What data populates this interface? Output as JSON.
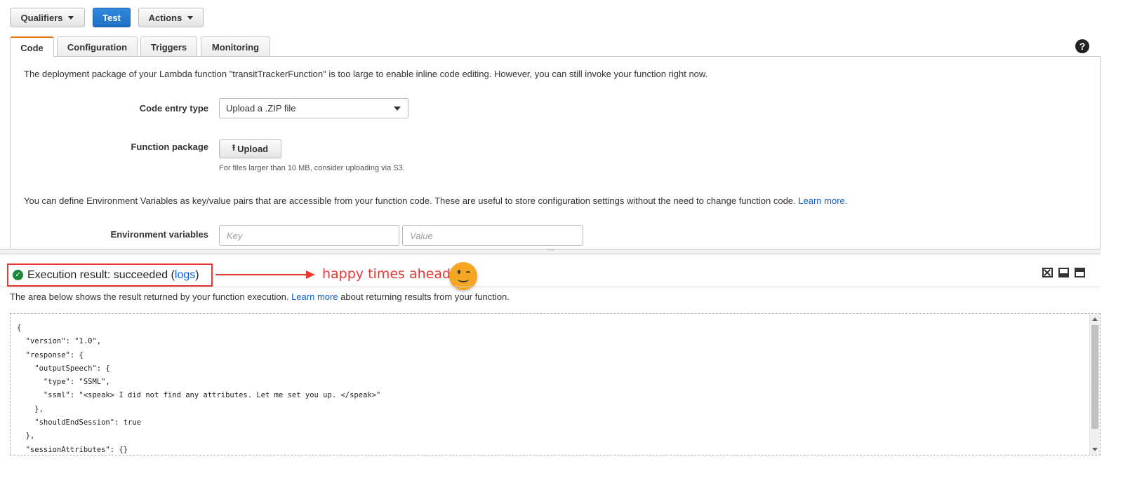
{
  "toolbar": {
    "qualifiers_label": "Qualifiers",
    "test_label": "Test",
    "actions_label": "Actions"
  },
  "tabs": [
    {
      "label": "Code",
      "active": true
    },
    {
      "label": "Configuration",
      "active": false
    },
    {
      "label": "Triggers",
      "active": false
    },
    {
      "label": "Monitoring",
      "active": false
    }
  ],
  "help_glyph": "?",
  "code_panel": {
    "package_notice": "The deployment package of your Lambda function \"transitTrackerFunction\" is too large to enable inline code editing. However, you can still invoke your function right now.",
    "code_entry_label": "Code entry type",
    "code_entry_value": "Upload a .ZIP file",
    "function_package_label": "Function package",
    "upload_label": "Upload",
    "upload_hint": "For files larger than 10 MB, consider uploading via S3.",
    "env_intro": "You can define Environment Variables as key/value pairs that are accessible from your function code. These are useful to store configuration settings without the need to change function code.",
    "env_learn_more": "Learn more.",
    "env_label": "Environment variables",
    "key_placeholder": "Key",
    "value_placeholder": "Value"
  },
  "splitter_grip": "''''",
  "result": {
    "title_prefix": "Execution result: succeeded (",
    "logs_link": "logs",
    "title_suffix": ")",
    "annotation": "happy times ahead...",
    "desc_prefix": "The area below shows the result returned by your function execution.",
    "desc_link": "Learn more",
    "desc_suffix": "about returning results from your function.",
    "output": "{\n  \"version\": \"1.0\",\n  \"response\": {\n    \"outputSpeech\": {\n      \"type\": \"SSML\",\n      \"ssml\": \"<speak> I did not find any attributes. Let me set you up. </speak>\"\n    },\n    \"shouldEndSession\": true\n  },\n  \"sessionAttributes\": {}"
  },
  "colors": {
    "accent_tab": "#e47911",
    "primary_button": "#1f6fc2",
    "success": "#1d8a3a",
    "annotation": "#e53935",
    "link": "#0b5ed7"
  }
}
